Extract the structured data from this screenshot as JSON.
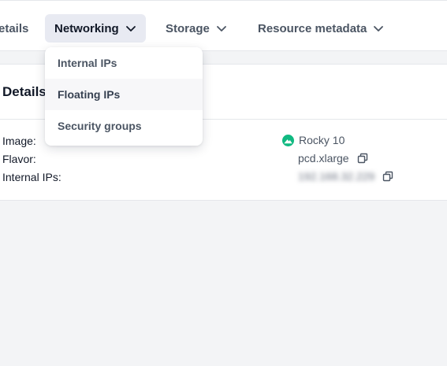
{
  "tabs": {
    "details_label": "etails",
    "networking_label": "Networking",
    "storage_label": "Storage",
    "resource_label": "Resource metadata"
  },
  "networking_menu": {
    "items": [
      "Internal IPs",
      "Floating IPs",
      "Security groups"
    ],
    "hovered": "Floating IPs"
  },
  "details": {
    "title": "Details",
    "image_label": "Image:",
    "flavor_label": "Flavor:",
    "internal_ips_label": "Internal IPs:",
    "image_value": "Rocky 10",
    "image_icon": "rocky-linux-logo-icon",
    "flavor_value": "pcd.xlarge",
    "internal_ips_value": "192.168.32.229"
  },
  "colors": {
    "accent_bg": "#e8eaf2",
    "rocky_green": "#10b981",
    "text_muted": "#4b5563"
  }
}
